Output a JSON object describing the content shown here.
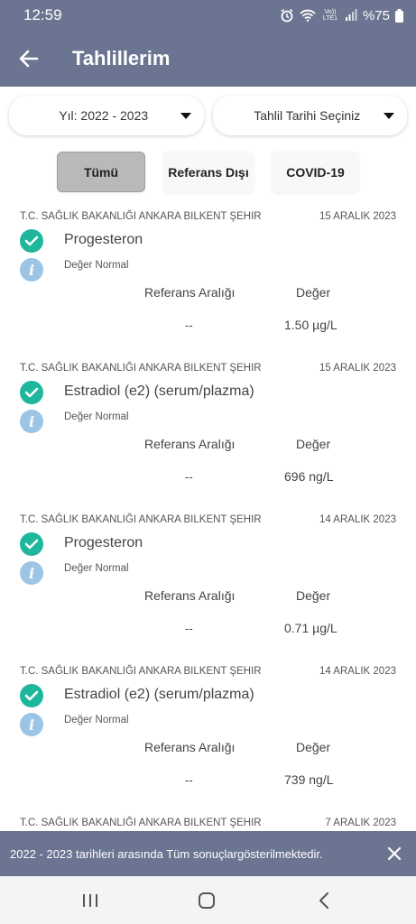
{
  "status_bar": {
    "time": "12:59",
    "network": "Vo)) LTE1",
    "battery": "%75"
  },
  "header": {
    "title": "Tahlillerim"
  },
  "filters": {
    "year": "Yıl: 2022 - 2023",
    "date": "Tahlil Tarihi Seçiniz"
  },
  "tabs": [
    {
      "label": "Tümü",
      "active": true
    },
    {
      "label": "Referans Dışı",
      "active": false
    },
    {
      "label": "COVID-19",
      "active": false
    }
  ],
  "results_header": {
    "reference": "Referans Aralığı",
    "value": "Değer"
  },
  "results": [
    {
      "hospital": "T.C. SAĞLIK BAKANLIĞI ANKARA BILKENT ŞEHIR",
      "date": "15 ARALIK 2023",
      "test": "Progesteron",
      "status": "Değer Normal",
      "reference": "--",
      "value": "1.50 µg/L"
    },
    {
      "hospital": "T.C. SAĞLIK BAKANLIĞI ANKARA BILKENT ŞEHIR",
      "date": "15 ARALIK 2023",
      "test": "Estradiol (e2) (serum/plazma)",
      "status": "Değer Normal",
      "reference": "--",
      "value": "696 ng/L"
    },
    {
      "hospital": "T.C. SAĞLIK BAKANLIĞI ANKARA BILKENT ŞEHIR",
      "date": "14 ARALIK 2023",
      "test": "Progesteron",
      "status": "Değer Normal",
      "reference": "--",
      "value": "0.71 µg/L"
    },
    {
      "hospital": "T.C. SAĞLIK BAKANLIĞI ANKARA BILKENT ŞEHIR",
      "date": "14 ARALIK 2023",
      "test": "Estradiol (e2) (serum/plazma)",
      "status": "Değer Normal",
      "reference": "--",
      "value": "739 ng/L"
    },
    {
      "hospital": "T.C. SAĞLIK BAKANLIĞI ANKARA BILKENT ŞEHIR",
      "date": "7 ARALIK 2023",
      "test": "",
      "status": "",
      "reference": "",
      "value": ""
    }
  ],
  "snackbar": {
    "message": "2022 - 2023 tarihleri arasında Tüm sonuçlargösterilmektedir."
  },
  "icons": {
    "back": "arrow-left-icon",
    "check": "check-circle-icon",
    "info": "info-icon",
    "close": "close-icon"
  },
  "colors": {
    "primary": "#6b7490",
    "success": "#1fb79b",
    "info": "#9cc4e4"
  }
}
